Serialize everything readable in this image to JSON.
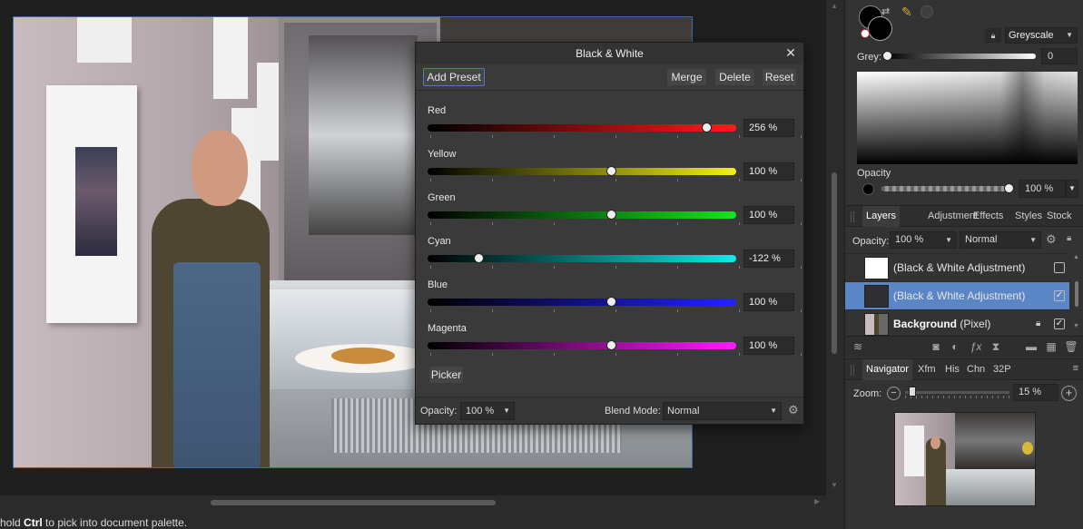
{
  "canvas": {
    "photo_alt": ""
  },
  "status_bar": {
    "prefix": "hold ",
    "key": "Ctrl",
    "suffix": " to pick into document palette."
  },
  "dialog": {
    "title": "Black & White",
    "buttons": {
      "add_preset": "Add Preset",
      "merge": "Merge",
      "delete": "Delete",
      "reset": "Reset",
      "picker": "Picker"
    },
    "sliders": [
      {
        "label": "Red",
        "value_text": "256 %",
        "fraction": 0.902,
        "gradient": [
          "#000000",
          "#ff1a1a"
        ]
      },
      {
        "label": "Yellow",
        "value_text": "100 %",
        "fraction": 0.593,
        "gradient": [
          "#000000",
          "#f2f01c"
        ]
      },
      {
        "label": "Green",
        "value_text": "100 %",
        "fraction": 0.593,
        "gradient": [
          "#000000",
          "#16e51c"
        ]
      },
      {
        "label": "Cyan",
        "value_text": "-122 %",
        "fraction": 0.166,
        "gradient": [
          "#000000",
          "#14e8e8"
        ]
      },
      {
        "label": "Blue",
        "value_text": "100 %",
        "fraction": 0.593,
        "gradient": [
          "#000000",
          "#2222ff"
        ]
      },
      {
        "label": "Magenta",
        "value_text": "100 %",
        "fraction": 0.593,
        "gradient": [
          "#000000",
          "#ff1aff"
        ]
      }
    ],
    "opacity_label": "Opacity:",
    "opacity_value": "100 %",
    "blend_label": "Blend Mode:",
    "blend_value": "Normal"
  },
  "color_panel": {
    "mode": "Greyscale",
    "grey_label": "Grey:",
    "grey_value": "0",
    "opacity_label": "Opacity",
    "opacity_value": "100 %"
  },
  "panel_tabs_1": {
    "tabs": [
      "Layers",
      "Adjustment",
      "Effects",
      "Styles",
      "Stock"
    ],
    "active": "Layers"
  },
  "layers": {
    "opacity_label": "Opacity:",
    "opacity_value": "100 %",
    "blend_value": "Normal",
    "rows": [
      {
        "name": "(Black & White Adjustment)",
        "suffix": "",
        "selected": false,
        "checked": false,
        "locked": false
      },
      {
        "name": "(Black & White Adjustment)",
        "suffix": "",
        "selected": true,
        "checked": true,
        "locked": false
      },
      {
        "name": "Background",
        "suffix": " (Pixel)",
        "selected": false,
        "checked": true,
        "locked": true
      }
    ]
  },
  "panel_tabs_2": {
    "tabs": [
      "Navigator",
      "Xfm",
      "His",
      "Chn",
      "32P"
    ],
    "active": "Navigator"
  },
  "navigator": {
    "zoom_label": "Zoom:",
    "zoom_value": "15 %"
  },
  "colors": {
    "accent": "#5b86c5",
    "selection_border": "#3a6ea8"
  }
}
